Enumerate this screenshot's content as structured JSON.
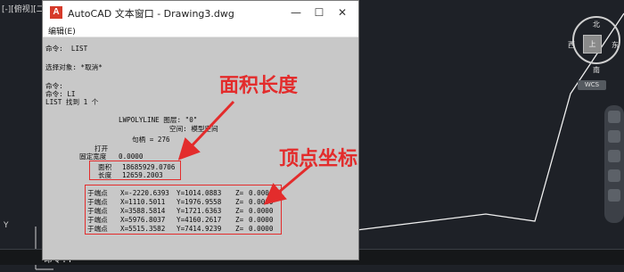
{
  "viewport_label": "[-][俯视][二",
  "command_line": {
    "prompt": "命令:"
  },
  "text_window": {
    "title": "AutoCAD 文本窗口 - Drawing3.dwg",
    "menu": [
      "编辑(E)"
    ],
    "lines": {
      "cmd_list": "命令:  LIST",
      "select": "选择对象: *取消*",
      "cmd_blank": "命令:",
      "cmd_li": "命令: LI",
      "found": "LIST 找到 1 个",
      "entity": "LWPOLYLINE 图层: \"0\"",
      "space": "空间: 模型空间",
      "handle": "句柄 = 276",
      "open": "打开",
      "width_label": "固定宽度",
      "width_value": "0.0000",
      "area_label": "面积",
      "area_value": "18685929.0706",
      "length_label": "长度",
      "length_value": "12659.2003"
    },
    "vertices": [
      {
        "label": "于端点",
        "x": "X=-2220.6393",
        "y": "Y=1014.0883",
        "z": "Z=",
        "zval": "0.0000"
      },
      {
        "label": "于端点",
        "x": "X=1110.5011",
        "y": "Y=1976.9558",
        "z": "Z=",
        "zval": "0.0000"
      },
      {
        "label": "于端点",
        "x": "X=3588.5814",
        "y": "Y=1721.6363",
        "z": "Z=",
        "zval": "0.0000"
      },
      {
        "label": "于端点",
        "x": "X=5976.8037",
        "y": "Y=4160.2617",
        "z": "Z=",
        "zval": "0.0000"
      },
      {
        "label": "于端点",
        "x": "X=5515.3582",
        "y": "Y=7414.9239",
        "z": "Z=",
        "zval": "0.0000"
      }
    ]
  },
  "annotations": {
    "area_length": "面积长度",
    "vertex_coords": "顶点坐标"
  },
  "compass": {
    "north": "北",
    "south": "南",
    "east": "东",
    "west": "西",
    "center": "上"
  },
  "wcs_label": "WCS",
  "ucs": {
    "y": "Y"
  },
  "colors": {
    "annotation": "#e32c2c",
    "canvas": "#1e2127",
    "text_bg": "#c8c8c8"
  }
}
